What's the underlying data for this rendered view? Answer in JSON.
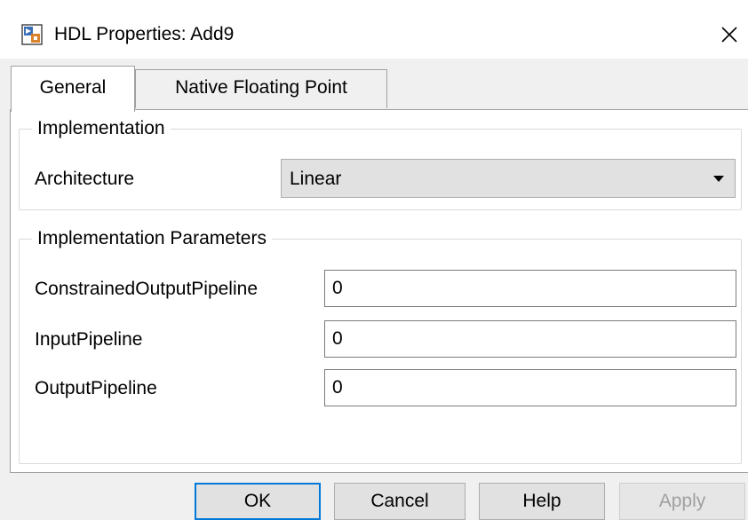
{
  "window": {
    "title": "HDL Properties: Add9",
    "close_glyph": "✕"
  },
  "icons": {
    "app": "hdl-properties-app-icon",
    "close": "close-icon",
    "dropdown": "chevron-down-icon"
  },
  "tabs": [
    {
      "label": "General",
      "selected": true
    },
    {
      "label": "Native Floating Point",
      "selected": false
    }
  ],
  "implementation": {
    "group_title": "Implementation",
    "architecture_label": "Architecture",
    "architecture_value": "Linear"
  },
  "parameters": {
    "group_title": "Implementation Parameters",
    "fields": [
      {
        "label": "ConstrainedOutputPipeline",
        "value": "0"
      },
      {
        "label": "InputPipeline",
        "value": "0"
      },
      {
        "label": "OutputPipeline",
        "value": "0"
      }
    ]
  },
  "buttons": {
    "ok": "OK",
    "cancel": "Cancel",
    "help": "Help",
    "apply": "Apply"
  },
  "colors": {
    "focus_border": "#0078d7",
    "window_bg": "#f0f0f0",
    "disabled_text": "#a0a0a0"
  }
}
